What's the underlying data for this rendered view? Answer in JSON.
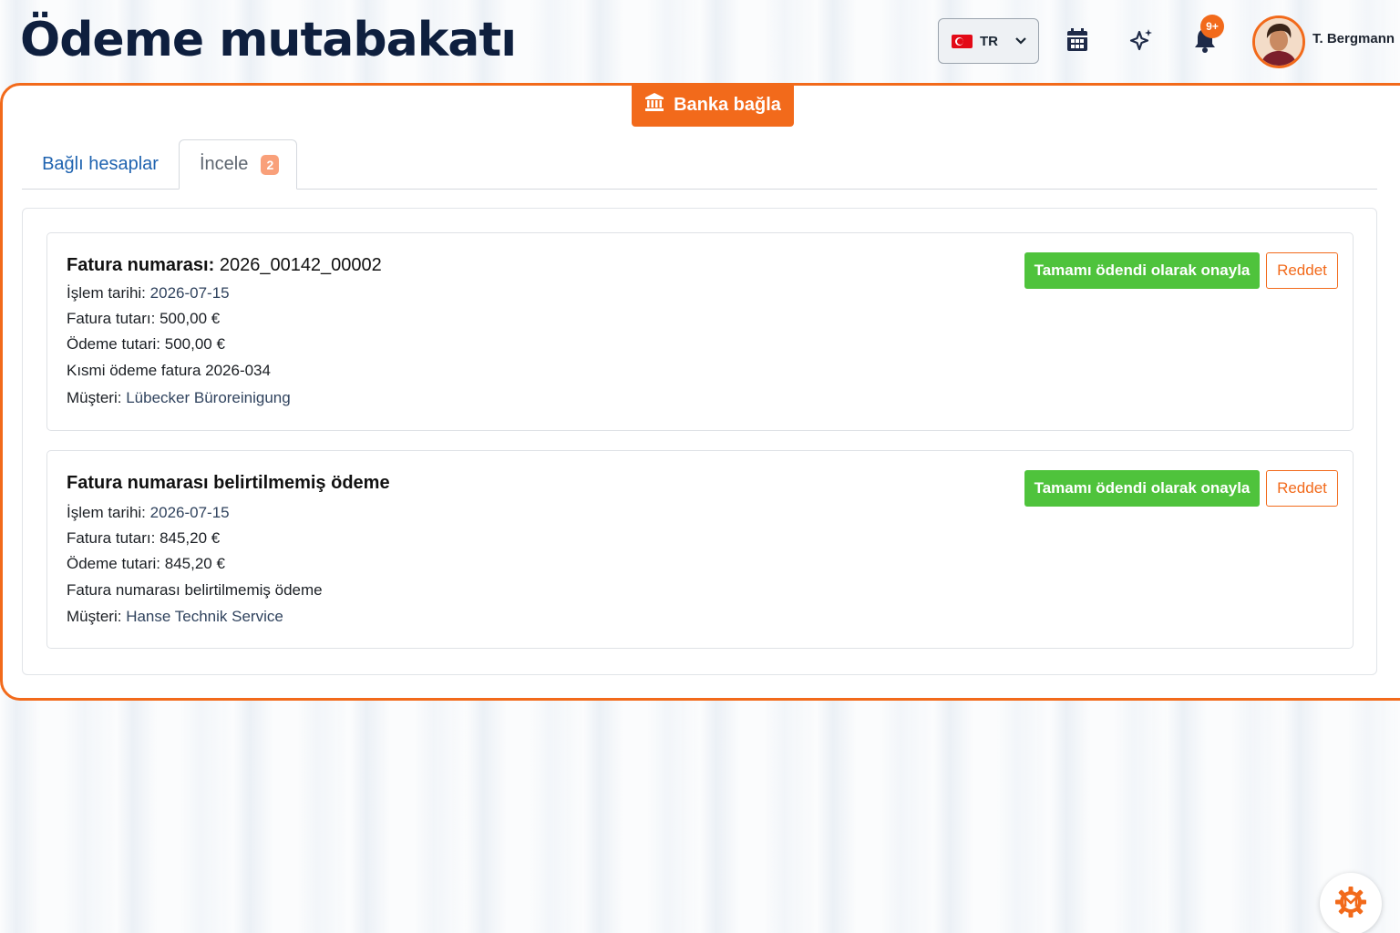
{
  "header": {
    "title": "Ödeme mutabakatı",
    "language": {
      "code": "TR",
      "flag_icon": "turkey-flag-icon"
    },
    "icons": [
      "calendar-icon",
      "sparkle-icon",
      "bell-icon"
    ],
    "notifications_badge": "9+",
    "user": {
      "name": "T. Bergmann"
    }
  },
  "actions": {
    "connect_bank_label": "Banka bağla"
  },
  "tabs": [
    {
      "label": "Bağlı hesaplar",
      "active": false
    },
    {
      "label": "İncele",
      "active": true,
      "badge": "2"
    }
  ],
  "colors": {
    "accent": "#f26a1b",
    "confirm": "#4fc33c",
    "link": "#1f63b0",
    "title": "#0e1f3e"
  },
  "payments": [
    {
      "title_label": "Fatura numarası:",
      "title_value": "2026_00142_00002",
      "date_label": "İşlem tarihi:",
      "date_value": "2026-07-15",
      "invoice_amount_label": "Fatura tutarı:",
      "invoice_amount_value": "500,00 €",
      "payment_amount_label": "Ödeme tutari:",
      "payment_amount_value": "500,00 €",
      "description": "Kısmi ödeme fatura 2026-034",
      "customer_label": "Müşteri:",
      "customer_value": "Lübecker Büroreinigung",
      "confirm_label": "Tamamı ödendi olarak onayla",
      "reject_label": "Reddet"
    },
    {
      "title_label": "Fatura numarası belirtilmemiş ödeme",
      "title_value": "",
      "date_label": "İşlem tarihi:",
      "date_value": "2026-07-15",
      "invoice_amount_label": "Fatura tutarı:",
      "invoice_amount_value": "845,20 €",
      "payment_amount_label": "Ödeme tutari:",
      "payment_amount_value": "845,20 €",
      "description": "Fatura numarası belirtilmemiş ödeme",
      "customer_label": "Müşteri:",
      "customer_value": "Hanse Technik Service",
      "confirm_label": "Tamamı ödendi olarak onayla",
      "reject_label": "Reddet"
    }
  ],
  "help_button": {
    "icon": "gear-logo-icon"
  }
}
